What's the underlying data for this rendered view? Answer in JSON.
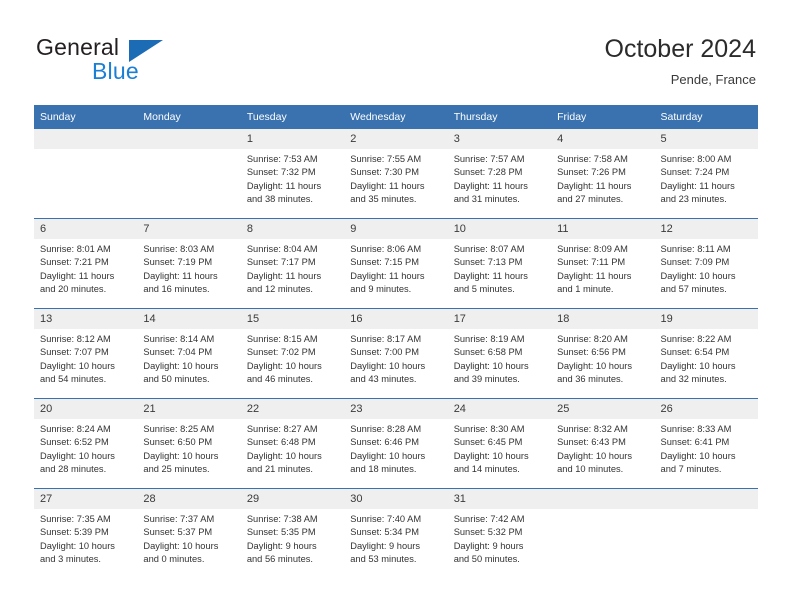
{
  "brand": {
    "name_part1": "General",
    "name_part2": "Blue",
    "mark_color": "#1b6cb5",
    "text_color": "#1b7fd4"
  },
  "header": {
    "title": "October 2024",
    "subtitle": "Pende, France"
  },
  "theme": {
    "header_blue": "#3a72b0",
    "daynum_band": "#efefef",
    "cell_background": "#ffffff",
    "text": "#333333"
  },
  "calendar": {
    "weekday_headers": [
      "Sunday",
      "Monday",
      "Tuesday",
      "Wednesday",
      "Thursday",
      "Friday",
      "Saturday"
    ],
    "weeks": [
      [
        {
          "day": "",
          "sunrise": "",
          "sunset": "",
          "daylight_line1": "",
          "daylight_line2": ""
        },
        {
          "day": "",
          "sunrise": "",
          "sunset": "",
          "daylight_line1": "",
          "daylight_line2": ""
        },
        {
          "day": "1",
          "sunrise": "Sunrise: 7:53 AM",
          "sunset": "Sunset: 7:32 PM",
          "daylight_line1": "Daylight: 11 hours",
          "daylight_line2": "and 38 minutes."
        },
        {
          "day": "2",
          "sunrise": "Sunrise: 7:55 AM",
          "sunset": "Sunset: 7:30 PM",
          "daylight_line1": "Daylight: 11 hours",
          "daylight_line2": "and 35 minutes."
        },
        {
          "day": "3",
          "sunrise": "Sunrise: 7:57 AM",
          "sunset": "Sunset: 7:28 PM",
          "daylight_line1": "Daylight: 11 hours",
          "daylight_line2": "and 31 minutes."
        },
        {
          "day": "4",
          "sunrise": "Sunrise: 7:58 AM",
          "sunset": "Sunset: 7:26 PM",
          "daylight_line1": "Daylight: 11 hours",
          "daylight_line2": "and 27 minutes."
        },
        {
          "day": "5",
          "sunrise": "Sunrise: 8:00 AM",
          "sunset": "Sunset: 7:24 PM",
          "daylight_line1": "Daylight: 11 hours",
          "daylight_line2": "and 23 minutes."
        }
      ],
      [
        {
          "day": "6",
          "sunrise": "Sunrise: 8:01 AM",
          "sunset": "Sunset: 7:21 PM",
          "daylight_line1": "Daylight: 11 hours",
          "daylight_line2": "and 20 minutes."
        },
        {
          "day": "7",
          "sunrise": "Sunrise: 8:03 AM",
          "sunset": "Sunset: 7:19 PM",
          "daylight_line1": "Daylight: 11 hours",
          "daylight_line2": "and 16 minutes."
        },
        {
          "day": "8",
          "sunrise": "Sunrise: 8:04 AM",
          "sunset": "Sunset: 7:17 PM",
          "daylight_line1": "Daylight: 11 hours",
          "daylight_line2": "and 12 minutes."
        },
        {
          "day": "9",
          "sunrise": "Sunrise: 8:06 AM",
          "sunset": "Sunset: 7:15 PM",
          "daylight_line1": "Daylight: 11 hours",
          "daylight_line2": "and 9 minutes."
        },
        {
          "day": "10",
          "sunrise": "Sunrise: 8:07 AM",
          "sunset": "Sunset: 7:13 PM",
          "daylight_line1": "Daylight: 11 hours",
          "daylight_line2": "and 5 minutes."
        },
        {
          "day": "11",
          "sunrise": "Sunrise: 8:09 AM",
          "sunset": "Sunset: 7:11 PM",
          "daylight_line1": "Daylight: 11 hours",
          "daylight_line2": "and 1 minute."
        },
        {
          "day": "12",
          "sunrise": "Sunrise: 8:11 AM",
          "sunset": "Sunset: 7:09 PM",
          "daylight_line1": "Daylight: 10 hours",
          "daylight_line2": "and 57 minutes."
        }
      ],
      [
        {
          "day": "13",
          "sunrise": "Sunrise: 8:12 AM",
          "sunset": "Sunset: 7:07 PM",
          "daylight_line1": "Daylight: 10 hours",
          "daylight_line2": "and 54 minutes."
        },
        {
          "day": "14",
          "sunrise": "Sunrise: 8:14 AM",
          "sunset": "Sunset: 7:04 PM",
          "daylight_line1": "Daylight: 10 hours",
          "daylight_line2": "and 50 minutes."
        },
        {
          "day": "15",
          "sunrise": "Sunrise: 8:15 AM",
          "sunset": "Sunset: 7:02 PM",
          "daylight_line1": "Daylight: 10 hours",
          "daylight_line2": "and 46 minutes."
        },
        {
          "day": "16",
          "sunrise": "Sunrise: 8:17 AM",
          "sunset": "Sunset: 7:00 PM",
          "daylight_line1": "Daylight: 10 hours",
          "daylight_line2": "and 43 minutes."
        },
        {
          "day": "17",
          "sunrise": "Sunrise: 8:19 AM",
          "sunset": "Sunset: 6:58 PM",
          "daylight_line1": "Daylight: 10 hours",
          "daylight_line2": "and 39 minutes."
        },
        {
          "day": "18",
          "sunrise": "Sunrise: 8:20 AM",
          "sunset": "Sunset: 6:56 PM",
          "daylight_line1": "Daylight: 10 hours",
          "daylight_line2": "and 36 minutes."
        },
        {
          "day": "19",
          "sunrise": "Sunrise: 8:22 AM",
          "sunset": "Sunset: 6:54 PM",
          "daylight_line1": "Daylight: 10 hours",
          "daylight_line2": "and 32 minutes."
        }
      ],
      [
        {
          "day": "20",
          "sunrise": "Sunrise: 8:24 AM",
          "sunset": "Sunset: 6:52 PM",
          "daylight_line1": "Daylight: 10 hours",
          "daylight_line2": "and 28 minutes."
        },
        {
          "day": "21",
          "sunrise": "Sunrise: 8:25 AM",
          "sunset": "Sunset: 6:50 PM",
          "daylight_line1": "Daylight: 10 hours",
          "daylight_line2": "and 25 minutes."
        },
        {
          "day": "22",
          "sunrise": "Sunrise: 8:27 AM",
          "sunset": "Sunset: 6:48 PM",
          "daylight_line1": "Daylight: 10 hours",
          "daylight_line2": "and 21 minutes."
        },
        {
          "day": "23",
          "sunrise": "Sunrise: 8:28 AM",
          "sunset": "Sunset: 6:46 PM",
          "daylight_line1": "Daylight: 10 hours",
          "daylight_line2": "and 18 minutes."
        },
        {
          "day": "24",
          "sunrise": "Sunrise: 8:30 AM",
          "sunset": "Sunset: 6:45 PM",
          "daylight_line1": "Daylight: 10 hours",
          "daylight_line2": "and 14 minutes."
        },
        {
          "day": "25",
          "sunrise": "Sunrise: 8:32 AM",
          "sunset": "Sunset: 6:43 PM",
          "daylight_line1": "Daylight: 10 hours",
          "daylight_line2": "and 10 minutes."
        },
        {
          "day": "26",
          "sunrise": "Sunrise: 8:33 AM",
          "sunset": "Sunset: 6:41 PM",
          "daylight_line1": "Daylight: 10 hours",
          "daylight_line2": "and 7 minutes."
        }
      ],
      [
        {
          "day": "27",
          "sunrise": "Sunrise: 7:35 AM",
          "sunset": "Sunset: 5:39 PM",
          "daylight_line1": "Daylight: 10 hours",
          "daylight_line2": "and 3 minutes."
        },
        {
          "day": "28",
          "sunrise": "Sunrise: 7:37 AM",
          "sunset": "Sunset: 5:37 PM",
          "daylight_line1": "Daylight: 10 hours",
          "daylight_line2": "and 0 minutes."
        },
        {
          "day": "29",
          "sunrise": "Sunrise: 7:38 AM",
          "sunset": "Sunset: 5:35 PM",
          "daylight_line1": "Daylight: 9 hours",
          "daylight_line2": "and 56 minutes."
        },
        {
          "day": "30",
          "sunrise": "Sunrise: 7:40 AM",
          "sunset": "Sunset: 5:34 PM",
          "daylight_line1": "Daylight: 9 hours",
          "daylight_line2": "and 53 minutes."
        },
        {
          "day": "31",
          "sunrise": "Sunrise: 7:42 AM",
          "sunset": "Sunset: 5:32 PM",
          "daylight_line1": "Daylight: 9 hours",
          "daylight_line2": "and 50 minutes."
        },
        {
          "day": "",
          "sunrise": "",
          "sunset": "",
          "daylight_line1": "",
          "daylight_line2": ""
        },
        {
          "day": "",
          "sunrise": "",
          "sunset": "",
          "daylight_line1": "",
          "daylight_line2": ""
        }
      ]
    ]
  }
}
